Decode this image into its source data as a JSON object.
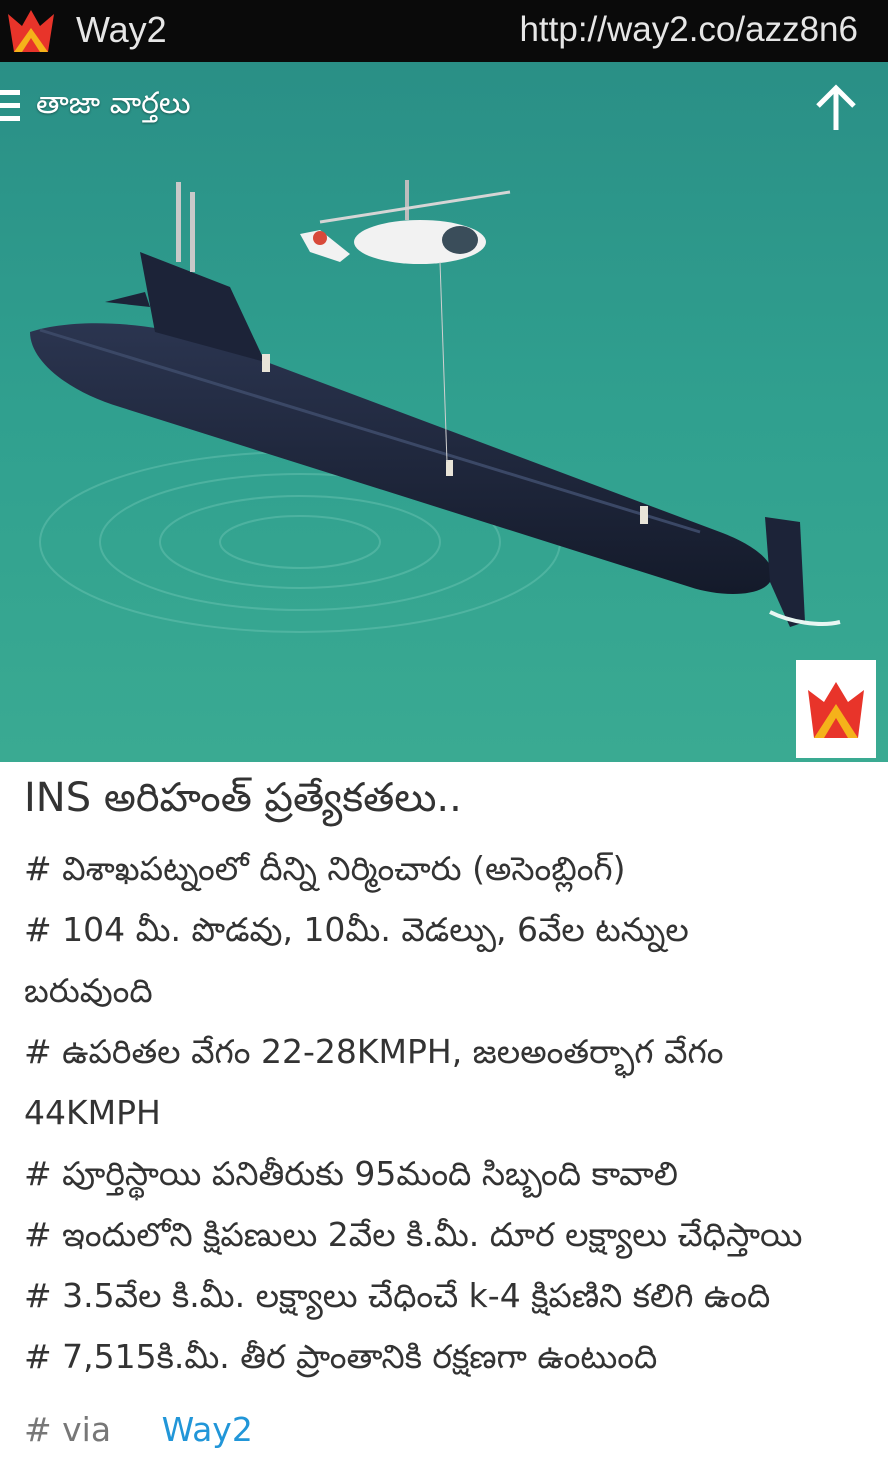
{
  "header": {
    "app_name": "Way2",
    "url": "http://way2.co/azz8n6"
  },
  "hero": {
    "menu_label": "తాజా వార్తలు"
  },
  "article": {
    "headline": "INS అరిహంత్ ప్రత్యేకతలు..",
    "lines": [
      "# విశాఖపట్నంలో దీన్ని నిర్మించారు (అసెంబ్లింగ్)",
      "# 104 మీ. పొడవు, 10మీ. వెడల్పు, 6వేల టన్నుల",
      "బరువుంది",
      "# ఉపరితల వేగం 22-28KMPH, జలఅంతర్భాగ వేగం",
      "44KMPH",
      "# పూర్తిస్థాయి పనితీరుకు 95మంది సిబ్బంది కావాలి",
      "# ఇందులోని క్షిపణులు 2వేల కి.మీ. దూర లక్ష్యాలు చేధిస్తాయి",
      "# 3.5వేల కి.మీ. లక్ష్యాలు చేధించే k-4 క్షిపణిని కలిగి ఉంది",
      "# 7,515కి.మీ. తీర ప్రాంతానికి రక్షణగా ఉంటుంది"
    ],
    "via_label": "# via",
    "via_link": "Way2"
  },
  "icons": {
    "logo": "way2-crown-logo",
    "menu": "hamburger-menu-icon",
    "up": "up-arrow-icon",
    "badge": "way2-crown-badge"
  },
  "colors": {
    "topbar": "#0a0a0a",
    "sea": "#2f9c8c",
    "link": "#2196d8",
    "text": "#333333"
  }
}
